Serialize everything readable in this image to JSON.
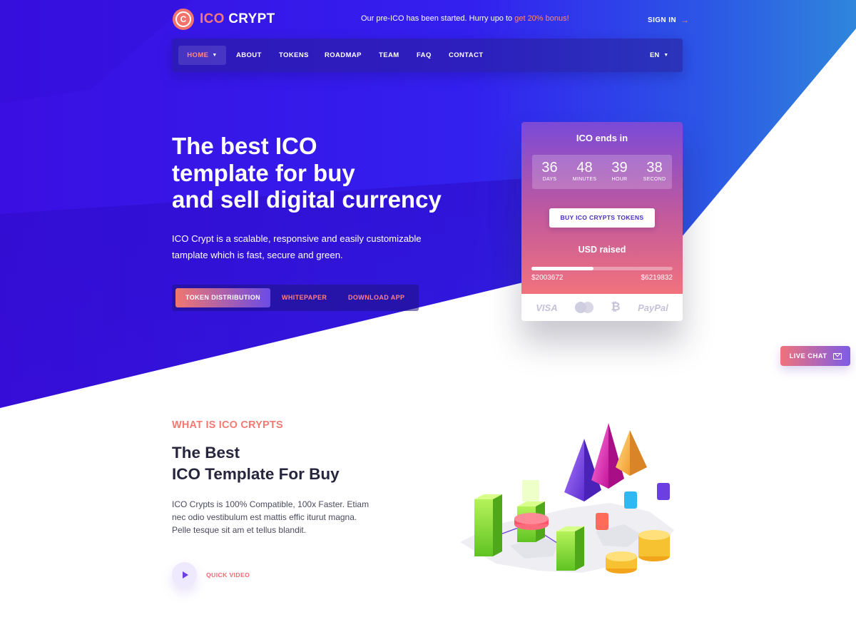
{
  "brand": {
    "part1": "ICO",
    "part2": "CRYPT"
  },
  "announcement": {
    "text": "Our pre-ICO has been started. Hurry upo to ",
    "highlight": "get 20% bonus!"
  },
  "header": {
    "sign_in": "SIGN IN"
  },
  "nav": {
    "items": [
      {
        "label": "HOME",
        "active": true
      },
      {
        "label": "ABOUT"
      },
      {
        "label": "TOKENS"
      },
      {
        "label": "ROADMAP"
      },
      {
        "label": "TEAM"
      },
      {
        "label": "FAQ"
      },
      {
        "label": "CONTACT"
      }
    ],
    "language": "EN"
  },
  "hero": {
    "title_lines": [
      "The best ICO",
      "template for buy",
      "and sell digital currency"
    ],
    "description_lines": [
      "ICO Crypt is a scalable, responsive and easily customizable",
      "tamplate which is fast, secure and green."
    ],
    "tabs": [
      {
        "label": "TOKEN DISTRIBUTION",
        "active": true
      },
      {
        "label": "WHITEPAPER"
      },
      {
        "label": "DOWNLOAD APP"
      }
    ]
  },
  "countdown": {
    "heading": "ICO ends in",
    "units": [
      {
        "value": "36",
        "label": "DAYS"
      },
      {
        "value": "48",
        "label": "MINUTES"
      },
      {
        "value": "39",
        "label": "HOUR"
      },
      {
        "value": "38",
        "label": "SECOND"
      }
    ],
    "buy_button": "BUY ICO CRYPTS TOKENS",
    "raised_label": "USD raised",
    "raised_current": "$2003672",
    "raised_target": "$6219832",
    "raised_progress": 0.44,
    "payment_methods": [
      "VISA",
      "MasterCard",
      "Bitcoin",
      "PayPal"
    ]
  },
  "live_chat": {
    "label": "LIVE CHAT"
  },
  "about": {
    "eyebrow": "WHAT IS ICO CRYPTS",
    "title_lines": [
      "The Best",
      "ICO Template For Buy"
    ],
    "text_lines": [
      "ICO Crypts is 100% Compatible, 100x Faster. Etiam",
      "nec odio vestibulum est mattis effic iturut magna.",
      "Pelle tesque sit am et tellus blandit."
    ],
    "video_label": "QUICK VIDEO"
  },
  "colors": {
    "accent": "#f37a72",
    "hero_purple": "#3a10e6",
    "hero_blue": "#2f7bdf",
    "text_dark": "#27253d"
  }
}
